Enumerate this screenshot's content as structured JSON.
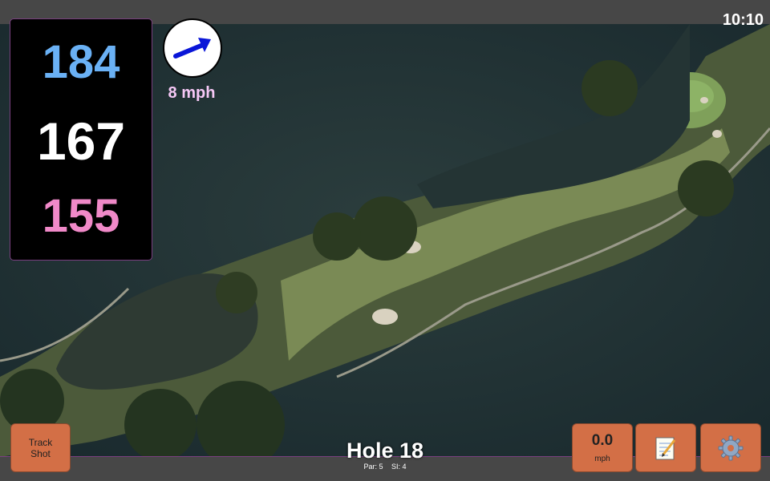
{
  "status_bar": {
    "time": "10:10"
  },
  "distances": {
    "back": "184",
    "center": "167",
    "front": "155"
  },
  "wind": {
    "speed": "8 mph",
    "direction_icon": "arrow-icon",
    "arrow_color": "#0a16d8"
  },
  "hole": {
    "title": "Hole 18",
    "par": "Par: 5",
    "si": "SI: 4"
  },
  "buttons": {
    "track_shot_label": "Track\nShot",
    "speed_value": "0.0",
    "speed_unit": "mph",
    "notes_icon": "notepad-icon",
    "settings_icon": "gear-icon"
  },
  "colors": {
    "back_distance": "#6ab1f5",
    "center_distance": "#ffffff",
    "front_distance": "#f089c8",
    "button": "#d36f46",
    "accent_border": "#7a3f80"
  }
}
